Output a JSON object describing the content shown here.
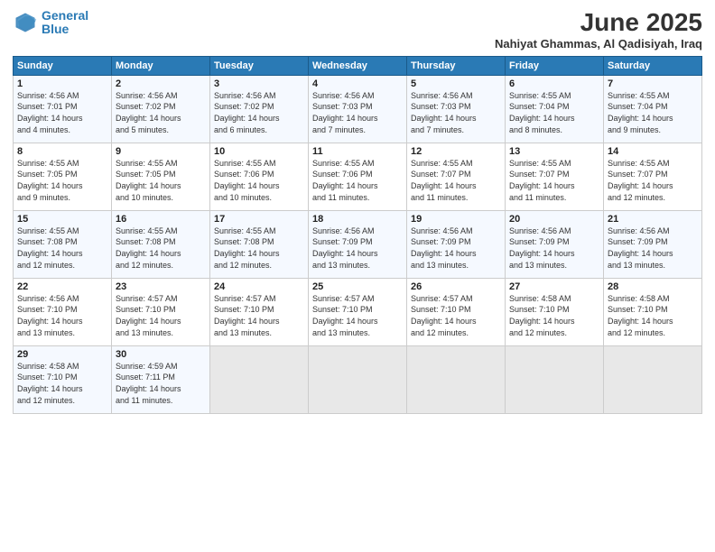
{
  "header": {
    "logo_line1": "General",
    "logo_line2": "Blue",
    "title": "June 2025",
    "subtitle": "Nahiyat Ghammas, Al Qadisiyah, Iraq"
  },
  "columns": [
    "Sunday",
    "Monday",
    "Tuesday",
    "Wednesday",
    "Thursday",
    "Friday",
    "Saturday"
  ],
  "weeks": [
    [
      {
        "day": "1",
        "detail": "Sunrise: 4:56 AM\nSunset: 7:01 PM\nDaylight: 14 hours\nand 4 minutes."
      },
      {
        "day": "2",
        "detail": "Sunrise: 4:56 AM\nSunset: 7:02 PM\nDaylight: 14 hours\nand 5 minutes."
      },
      {
        "day": "3",
        "detail": "Sunrise: 4:56 AM\nSunset: 7:02 PM\nDaylight: 14 hours\nand 6 minutes."
      },
      {
        "day": "4",
        "detail": "Sunrise: 4:56 AM\nSunset: 7:03 PM\nDaylight: 14 hours\nand 7 minutes."
      },
      {
        "day": "5",
        "detail": "Sunrise: 4:56 AM\nSunset: 7:03 PM\nDaylight: 14 hours\nand 7 minutes."
      },
      {
        "day": "6",
        "detail": "Sunrise: 4:55 AM\nSunset: 7:04 PM\nDaylight: 14 hours\nand 8 minutes."
      },
      {
        "day": "7",
        "detail": "Sunrise: 4:55 AM\nSunset: 7:04 PM\nDaylight: 14 hours\nand 9 minutes."
      }
    ],
    [
      {
        "day": "8",
        "detail": "Sunrise: 4:55 AM\nSunset: 7:05 PM\nDaylight: 14 hours\nand 9 minutes."
      },
      {
        "day": "9",
        "detail": "Sunrise: 4:55 AM\nSunset: 7:05 PM\nDaylight: 14 hours\nand 10 minutes."
      },
      {
        "day": "10",
        "detail": "Sunrise: 4:55 AM\nSunset: 7:06 PM\nDaylight: 14 hours\nand 10 minutes."
      },
      {
        "day": "11",
        "detail": "Sunrise: 4:55 AM\nSunset: 7:06 PM\nDaylight: 14 hours\nand 11 minutes."
      },
      {
        "day": "12",
        "detail": "Sunrise: 4:55 AM\nSunset: 7:07 PM\nDaylight: 14 hours\nand 11 minutes."
      },
      {
        "day": "13",
        "detail": "Sunrise: 4:55 AM\nSunset: 7:07 PM\nDaylight: 14 hours\nand 11 minutes."
      },
      {
        "day": "14",
        "detail": "Sunrise: 4:55 AM\nSunset: 7:07 PM\nDaylight: 14 hours\nand 12 minutes."
      }
    ],
    [
      {
        "day": "15",
        "detail": "Sunrise: 4:55 AM\nSunset: 7:08 PM\nDaylight: 14 hours\nand 12 minutes."
      },
      {
        "day": "16",
        "detail": "Sunrise: 4:55 AM\nSunset: 7:08 PM\nDaylight: 14 hours\nand 12 minutes."
      },
      {
        "day": "17",
        "detail": "Sunrise: 4:55 AM\nSunset: 7:08 PM\nDaylight: 14 hours\nand 12 minutes."
      },
      {
        "day": "18",
        "detail": "Sunrise: 4:56 AM\nSunset: 7:09 PM\nDaylight: 14 hours\nand 13 minutes."
      },
      {
        "day": "19",
        "detail": "Sunrise: 4:56 AM\nSunset: 7:09 PM\nDaylight: 14 hours\nand 13 minutes."
      },
      {
        "day": "20",
        "detail": "Sunrise: 4:56 AM\nSunset: 7:09 PM\nDaylight: 14 hours\nand 13 minutes."
      },
      {
        "day": "21",
        "detail": "Sunrise: 4:56 AM\nSunset: 7:09 PM\nDaylight: 14 hours\nand 13 minutes."
      }
    ],
    [
      {
        "day": "22",
        "detail": "Sunrise: 4:56 AM\nSunset: 7:10 PM\nDaylight: 14 hours\nand 13 minutes."
      },
      {
        "day": "23",
        "detail": "Sunrise: 4:57 AM\nSunset: 7:10 PM\nDaylight: 14 hours\nand 13 minutes."
      },
      {
        "day": "24",
        "detail": "Sunrise: 4:57 AM\nSunset: 7:10 PM\nDaylight: 14 hours\nand 13 minutes."
      },
      {
        "day": "25",
        "detail": "Sunrise: 4:57 AM\nSunset: 7:10 PM\nDaylight: 14 hours\nand 13 minutes."
      },
      {
        "day": "26",
        "detail": "Sunrise: 4:57 AM\nSunset: 7:10 PM\nDaylight: 14 hours\nand 12 minutes."
      },
      {
        "day": "27",
        "detail": "Sunrise: 4:58 AM\nSunset: 7:10 PM\nDaylight: 14 hours\nand 12 minutes."
      },
      {
        "day": "28",
        "detail": "Sunrise: 4:58 AM\nSunset: 7:10 PM\nDaylight: 14 hours\nand 12 minutes."
      }
    ],
    [
      {
        "day": "29",
        "detail": "Sunrise: 4:58 AM\nSunset: 7:10 PM\nDaylight: 14 hours\nand 12 minutes."
      },
      {
        "day": "30",
        "detail": "Sunrise: 4:59 AM\nSunset: 7:11 PM\nDaylight: 14 hours\nand 11 minutes."
      },
      {
        "day": "",
        "detail": ""
      },
      {
        "day": "",
        "detail": ""
      },
      {
        "day": "",
        "detail": ""
      },
      {
        "day": "",
        "detail": ""
      },
      {
        "day": "",
        "detail": ""
      }
    ]
  ]
}
